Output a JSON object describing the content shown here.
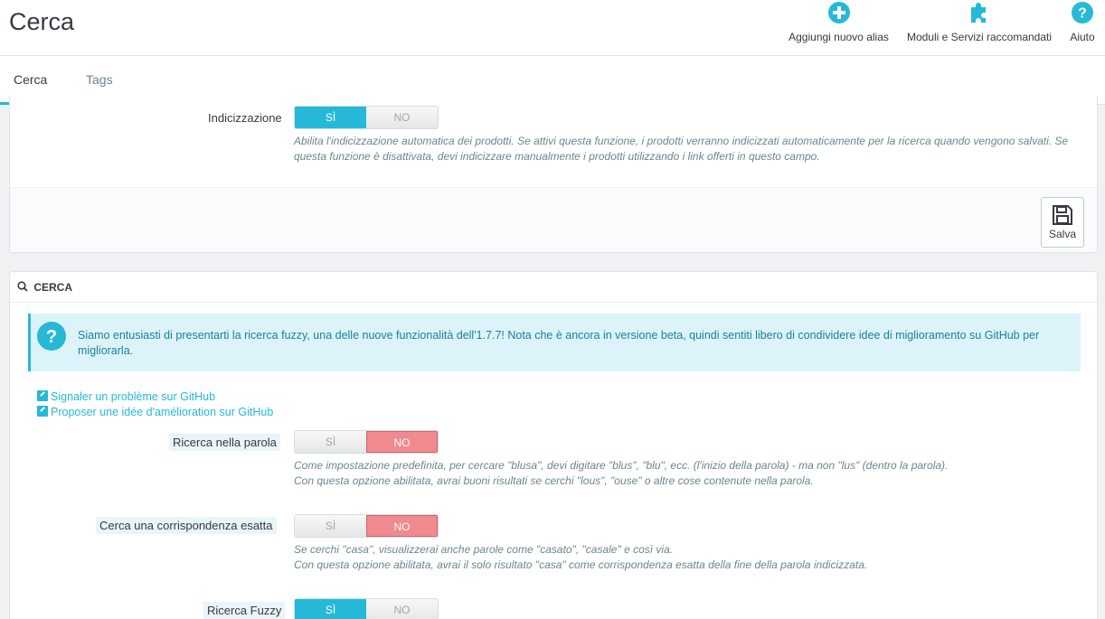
{
  "header": {
    "title": "Cerca",
    "toolbar": [
      {
        "label": "Aggiungi nuovo alias",
        "icon": "plus-circle-icon"
      },
      {
        "label": "Moduli e Servizi raccomandati",
        "icon": "puzzle-icon"
      },
      {
        "label": "Aiuto",
        "icon": "help-circle-icon"
      }
    ]
  },
  "tabs": [
    {
      "label": "Cerca",
      "active": true
    },
    {
      "label": "Tags",
      "active": false
    }
  ],
  "indexing_panel": {
    "label": "Indicizzazione",
    "yes": "SÌ",
    "no": "NO",
    "value": "yes",
    "help": "Abilita l'indicizzazione automatica dei prodotti. Se attivi questa funzione, i prodotti verranno indicizzati automaticamente per la ricerca quando vengono salvati. Se questa funzione è disattivata, devi indicizzare manualmente i prodotti utilizzando i link offerti in questo campo.",
    "save_label": "Salva"
  },
  "search_panel": {
    "heading": "CERCA",
    "alert": "Siamo entusiasti di presentarti la ricerca fuzzy, una delle nuove funzionalità dell'1.7.7! Nota che è ancora in versione beta, quindi sentiti libero di condividere idee di miglioramento su GitHub per migliorarla.",
    "links": [
      "Signaler un problème sur GitHub",
      "Proposer une idée d'amélioration sur GitHub"
    ],
    "fields": [
      {
        "label": "Ricerca nella parola",
        "yes": "SÌ",
        "no": "NO",
        "value": "no",
        "help1": "Come impostazione predefinita, per cercare \"blusa\", devi digitare \"blus\", \"blu\", ecc. (l'inizio della parola) - ma non \"lus\" (dentro la parola).",
        "help2": "Con questa opzione abilitata, avrai buoni risultati se cerchi \"lous\", \"ouse\" o altre cose contenute nella parola."
      },
      {
        "label": "Cerca una corrispondenza esatta",
        "yes": "SÌ",
        "no": "NO",
        "value": "no",
        "help1": "Se cerchi \"casa\", visualizzerai anche parole come \"casato\", \"casale\" e così via.",
        "help2": "Con questa opzione abilitata, avrai il solo risultato \"casa\" come corrispondenza esatta della fine della parola indicizzata."
      },
      {
        "label": "Ricerca Fuzzy",
        "yes": "SÌ",
        "no": "NO",
        "value": "yes"
      }
    ]
  },
  "colors": {
    "accent": "#25b9d7",
    "danger": "#f08a8f",
    "alert_bg": "#dcf4f9"
  }
}
